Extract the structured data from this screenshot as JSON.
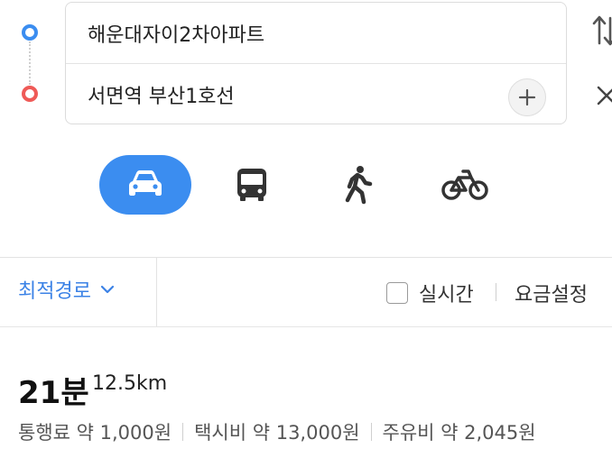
{
  "route": {
    "origin": "해운대자이2차아파트",
    "destination": "서면역 부산1호선",
    "add_stop_icon": "plus-icon",
    "swap_icon": "swap-vertical-icon",
    "close_icon": "close-icon"
  },
  "modes": [
    {
      "name": "car",
      "icon": "car-icon",
      "selected": true
    },
    {
      "name": "bus",
      "icon": "bus-icon",
      "selected": false
    },
    {
      "name": "walk",
      "icon": "walk-icon",
      "selected": false
    },
    {
      "name": "bike",
      "icon": "bicycle-icon",
      "selected": false
    }
  ],
  "options": {
    "route_option": "최적경로",
    "realtime_label": "실시간",
    "realtime_checked": false,
    "fare_settings": "요금설정"
  },
  "summary": {
    "time": "21분",
    "distance": "12.5km",
    "toll": "통행료 약 1,000원",
    "taxi": "택시비 약 13,000원",
    "fuel": "주유비 약 2,045원"
  },
  "colors": {
    "accent": "#3b8df0",
    "origin_dot": "#3b8df0",
    "destination_dot": "#ef5a57",
    "link_text": "#3b82e6"
  }
}
